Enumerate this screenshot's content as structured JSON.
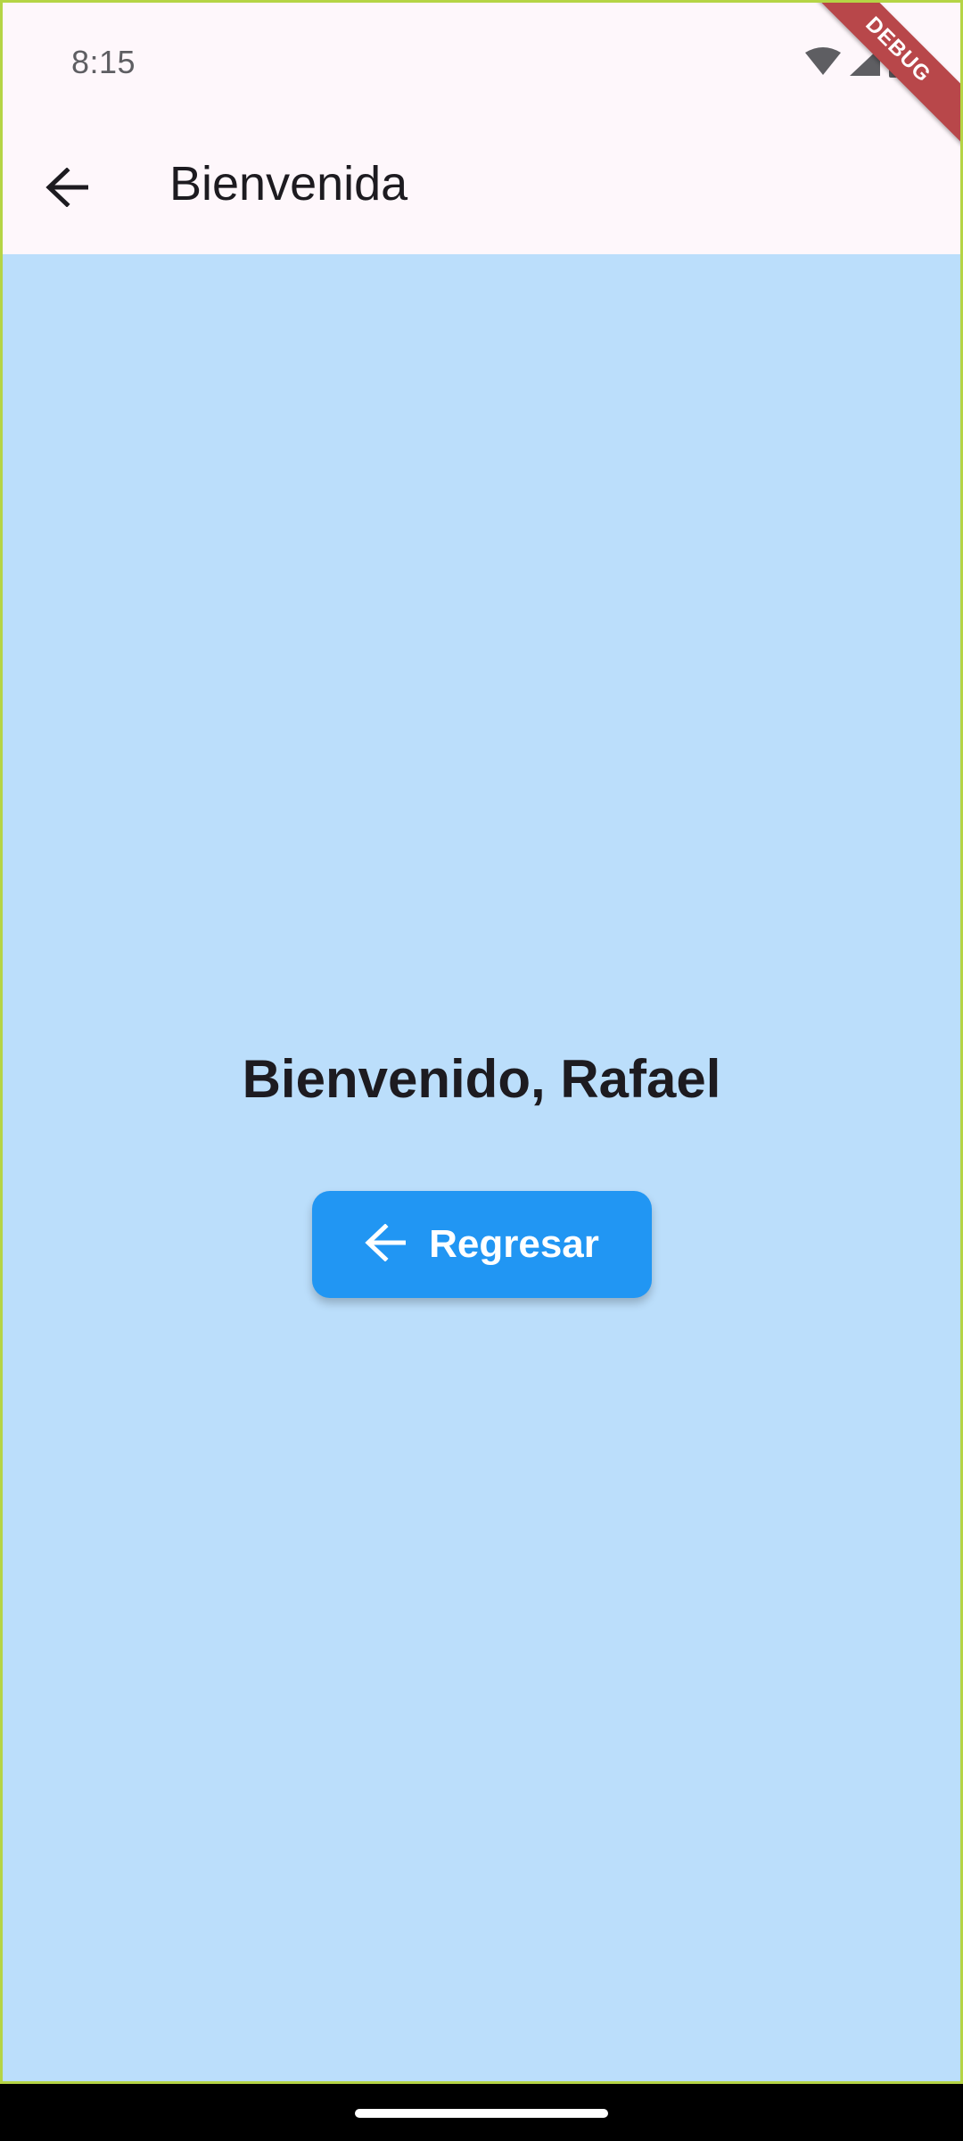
{
  "status_bar": {
    "time": "8:15",
    "icons": [
      "wifi-icon",
      "signal-icon",
      "battery-icon"
    ]
  },
  "app_bar": {
    "back_icon": "arrow-back-icon",
    "title": "Bienvenida"
  },
  "main": {
    "welcome_text": "Bienvenido, Rafael",
    "button": {
      "icon": "arrow-back-icon",
      "label": "Regresar"
    }
  },
  "debug_banner": "DEBUG",
  "colors": {
    "app_bar_bg": "#fef7fb",
    "body_bg": "#bbdefb",
    "button_bg": "#2196f3",
    "text_primary": "#1d1b20",
    "debug_ribbon": "#b8474a"
  }
}
